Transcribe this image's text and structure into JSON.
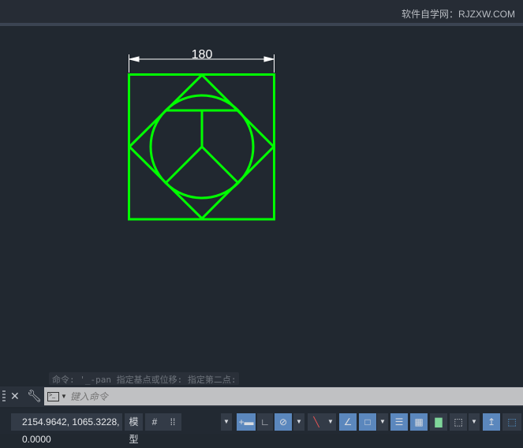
{
  "watermark": "软件自学网：RJZXW.COM",
  "drawing": {
    "dimension_text": "180",
    "line_color": "#00ff00"
  },
  "command": {
    "history": "命令: '_-pan 指定基点或位移:  指定第二点:",
    "placeholder": "键入命令"
  },
  "status": {
    "coordinates": "2154.9642, 1065.3228, 0.0000",
    "model_label": "模型"
  }
}
